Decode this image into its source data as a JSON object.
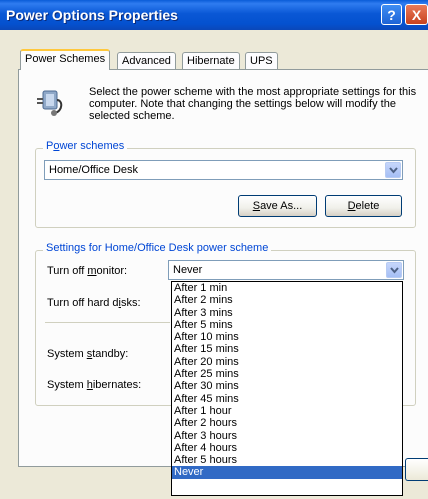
{
  "window": {
    "title": "Power Options Properties"
  },
  "title_buttons": {
    "help": "?",
    "close": "X"
  },
  "tabs": [
    {
      "pre": "",
      "key": "",
      "post": "Power Schemes"
    },
    {
      "pre": "",
      "key": "",
      "post": "Advanced"
    },
    {
      "pre": "",
      "key": "",
      "post": "Hibernate"
    },
    {
      "pre": "",
      "key": "",
      "post": "UPS"
    }
  ],
  "intro": {
    "text": "Select the power scheme with the most appropriate settings for this computer. Note that changing the settings below will modify the selected scheme."
  },
  "power_schemes": {
    "label_pre": "P",
    "label_key": "o",
    "label_post": "wer schemes",
    "selected": "Home/Office Desk",
    "save_as": {
      "pre": "",
      "key": "S",
      "post": "ave As..."
    },
    "delete": {
      "pre": "",
      "key": "D",
      "post": "elete"
    }
  },
  "settings": {
    "group_label": "Settings for Home/Office Desk power scheme",
    "monitor": {
      "pre": "Turn off ",
      "key": "m",
      "post": "onitor:",
      "value": "Never"
    },
    "hard_disks": {
      "pre": "Turn off hard d",
      "key": "i",
      "post": "sks:"
    },
    "standby": {
      "pre": "System ",
      "key": "s",
      "post": "tandby:"
    },
    "hibernates": {
      "pre": "System ",
      "key": "h",
      "post": "ibernates:"
    }
  },
  "monitor_options": [
    "After 1 min",
    "After 2 mins",
    "After 3 mins",
    "After 5 mins",
    "After 10 mins",
    "After 15 mins",
    "After 20 mins",
    "After 25 mins",
    "After 30 mins",
    "After 45 mins",
    "After 1 hour",
    "After 2 hours",
    "After 3 hours",
    "After 4 hours",
    "After 5 hours",
    "Never"
  ],
  "monitor_selected_index": 15,
  "colors": {
    "accent": "#316ac5",
    "titlebar": "#0a58d6",
    "group_label": "#0046d5"
  }
}
